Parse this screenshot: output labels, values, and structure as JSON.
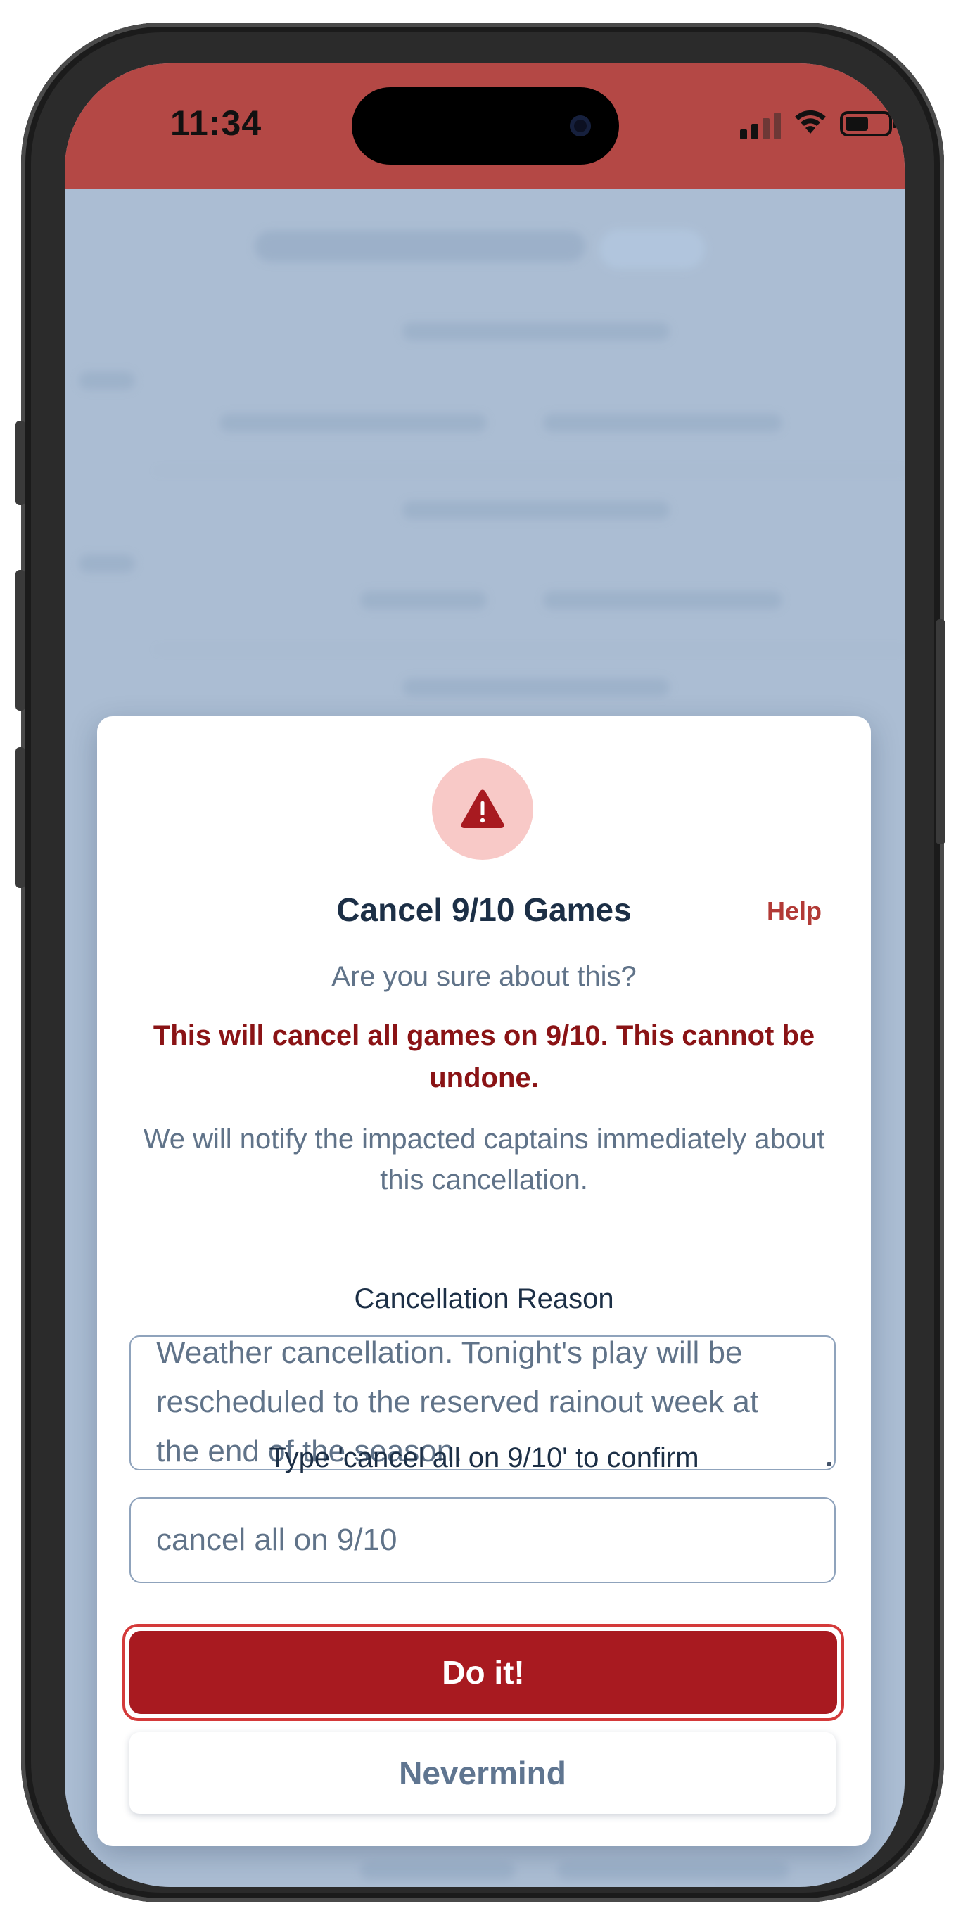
{
  "status_bar": {
    "time": "11:34",
    "icons": [
      "cellular-signal-icon",
      "wifi-icon",
      "battery-icon"
    ],
    "color": "#b44845"
  },
  "modal": {
    "icon": "warning-triangle-icon",
    "title": "Cancel 9/10 Games",
    "help_label": "Help",
    "subtitle": "Are you sure about this?",
    "warning": "This will cancel all games on 9/10. This cannot be undone.",
    "notify": "We will notify the impacted captains immediately about this cancellation.",
    "reason_label": "Cancellation Reason",
    "reason_value": "Weather cancellation. Tonight's play will be rescheduled to the reserved rainout week at the end of the season.",
    "confirm_label": "Type 'cancel all on 9/10' to confirm",
    "confirm_value": "cancel all on 9/10",
    "primary_button": "Do it!",
    "secondary_button": "Nevermind"
  },
  "colors": {
    "primary": "#a81a20",
    "warning_text": "#8a1315",
    "title_text": "#1c2f46",
    "muted_text": "#607389",
    "warn_circle": "#f8c9c7"
  }
}
